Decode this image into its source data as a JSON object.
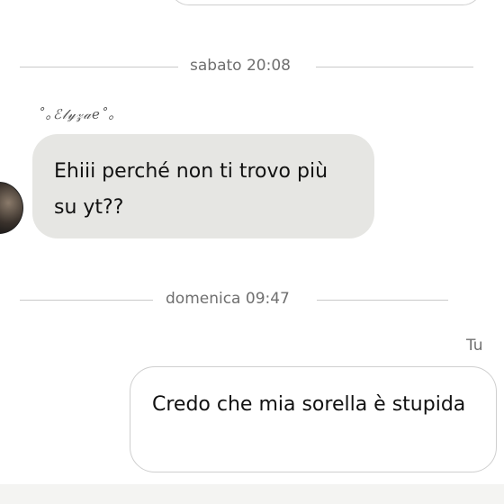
{
  "dividers": [
    {
      "label": "sabato 20:08"
    },
    {
      "label": "domenica 09:47"
    }
  ],
  "incoming": {
    "sender_name": "˚｡ℰ𝓁𝓎𝓏𝒶𝑒˚｡",
    "text": "Ehiii perché non ti trovo più su yt??"
  },
  "outgoing": {
    "sender_label": "Tu",
    "text": "Credo che mia sorella è stupida"
  },
  "colors": {
    "incoming_bubble": "#e6e6e3",
    "outgoing_border": "#cfcfcf",
    "timestamp_text": "#6f6f6f"
  }
}
